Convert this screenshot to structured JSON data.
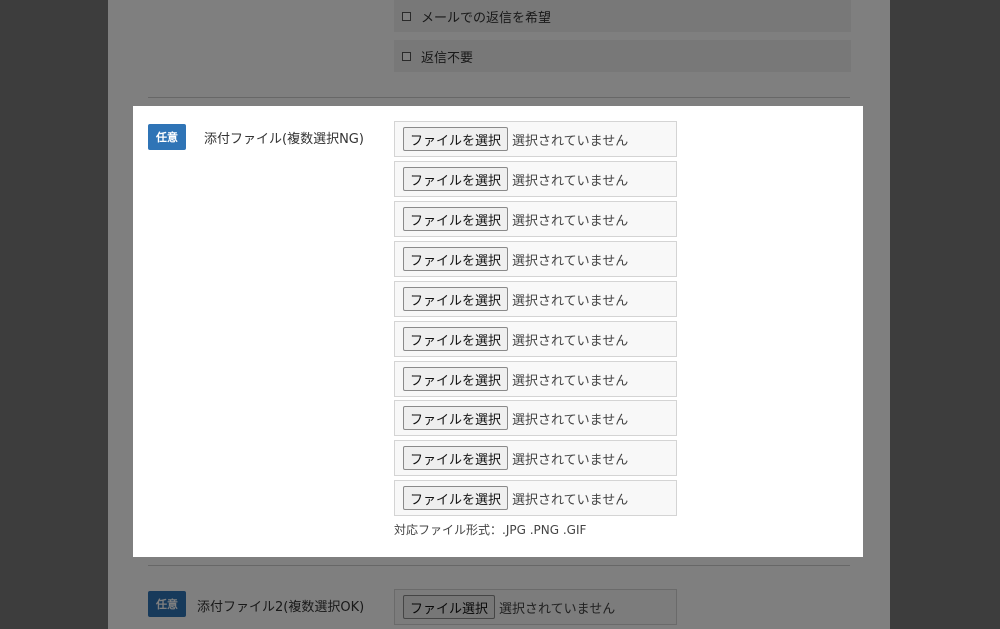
{
  "top_options": [
    {
      "label": "メールでの返信を希望"
    },
    {
      "label": "返信不要"
    }
  ],
  "section1": {
    "badge": "任意",
    "label": "添付ファイル(複数選択NG)",
    "file_inputs": [
      {
        "button": "ファイルを選択",
        "status": "選択されていません"
      },
      {
        "button": "ファイルを選択",
        "status": "選択されていません"
      },
      {
        "button": "ファイルを選択",
        "status": "選択されていません"
      },
      {
        "button": "ファイルを選択",
        "status": "選択されていません"
      },
      {
        "button": "ファイルを選択",
        "status": "選択されていません"
      },
      {
        "button": "ファイルを選択",
        "status": "選択されていません"
      },
      {
        "button": "ファイルを選択",
        "status": "選択されていません"
      },
      {
        "button": "ファイルを選択",
        "status": "選択されていません"
      },
      {
        "button": "ファイルを選択",
        "status": "選択されていません"
      },
      {
        "button": "ファイルを選択",
        "status": "選択されていません"
      }
    ],
    "formats": "対応ファイル形式：.JPG .PNG .GIF"
  },
  "section2": {
    "badge": "任意",
    "label": "添付ファイル2(複数選択OK)",
    "button": "ファイル選択",
    "status": "選択されていません"
  },
  "colors": {
    "badge": "#2f74b6",
    "overlay": "rgba(0,0,0,0.5)"
  }
}
